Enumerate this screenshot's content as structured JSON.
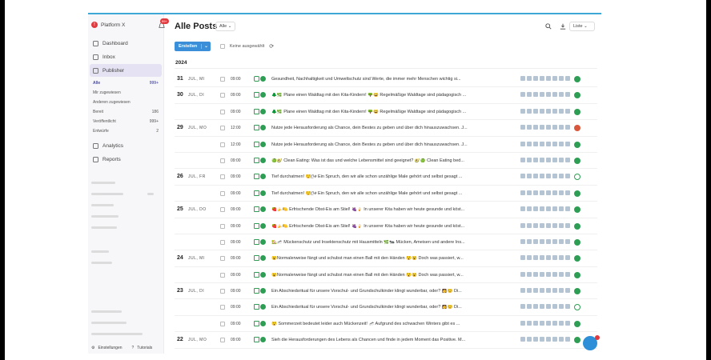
{
  "app": {
    "brand": "Platform X",
    "notification_badge": "99+",
    "title": "Alle Posts",
    "filter_value": "Alle",
    "view_value": "Liste",
    "create_label": "Erstellen",
    "selection_text": "Keine ausgewählt",
    "year": "2024"
  },
  "sidebar": {
    "nav": [
      {
        "label": "Dashboard",
        "icon": "home-icon"
      },
      {
        "label": "Inbox",
        "icon": "inbox-icon"
      },
      {
        "label": "Publisher",
        "icon": "publisher-icon",
        "active": true
      }
    ],
    "sub": [
      {
        "label": "Alle",
        "count": "999+",
        "active": true
      },
      {
        "label": "Mir zugewiesen",
        "count": ""
      },
      {
        "label": "Anderen zugewiesen",
        "count": ""
      },
      {
        "label": "Bereit",
        "count": "186"
      },
      {
        "label": "Veröffentlicht",
        "count": "999+"
      },
      {
        "label": "Entwürfe",
        "count": "2"
      }
    ],
    "nav2": [
      {
        "label": "Analytics",
        "icon": "analytics-icon"
      },
      {
        "label": "Reports",
        "icon": "reports-icon"
      }
    ],
    "footer_settings": "Einstellungen",
    "footer_tutorials": "Tutorials"
  },
  "rows": [
    {
      "day": "31",
      "dow": "JUL, MI",
      "time": "09:00",
      "ch": "link",
      "status": "green",
      "text": "Gesundheit, Nachhaltigkeit und Umweltschutz sind Werte, die immer mehr Menschen wichtig si..."
    },
    {
      "day": "30",
      "dow": "JUL, DI",
      "time": "09:00",
      "ch": "mail",
      "status": "green",
      "text": "🌲🌿 Plane einen Waldtag mit den Kita-Kindern! 🌳😀 Regelmäßige Waldtage sind pädagogisch ..."
    },
    {
      "day": "",
      "dow": "",
      "time": "09:00",
      "ch": "mail",
      "status": "green",
      "text": "🌲🌿 Plane einen Waldtag mit den Kita-Kindern! 🌳😀 Regelmäßige Waldtage sind pädagogisch ..."
    },
    {
      "day": "29",
      "dow": "JUL, MO",
      "time": "12:00",
      "ch": "mail",
      "status": "red",
      "text": "Nutze jede Herausforderung als Chance, dein Bestes zu geben und über dich hinauszuwachsen. J..."
    },
    {
      "day": "",
      "dow": "",
      "time": "12:00",
      "ch": "mail",
      "status": "green",
      "text": "Nutze jede Herausforderung als Chance, dein Bestes zu geben und über dich hinauszuwachsen. J..."
    },
    {
      "day": "",
      "dow": "",
      "time": "09:00",
      "ch": "mail",
      "status": "green",
      "text": "🍏🥑 Clean Eating: Was ist das und welche Lebensmittel sind geeignet? 🥑🍏 Clean Eating bed..."
    },
    {
      "day": "26",
      "dow": "JUL, FR",
      "time": "09:00",
      "ch": "mail",
      "status": "outline",
      "text": "Tief durchatmen! 😌🌬 Ein Spruch, den wir alle schon unzählige Male gehört und selbst gesagt ..."
    },
    {
      "day": "",
      "dow": "",
      "time": "09:00",
      "ch": "mail",
      "status": "green",
      "text": "Tief durchatmen! 😌🌬 Ein Spruch, den wir alle schon unzählige Male gehört und selbst gesagt ..."
    },
    {
      "day": "25",
      "dow": "JUL, DO",
      "time": "09:00",
      "ch": "mail",
      "status": "green",
      "text": "🍓🍌🍋 Erfrischende Obst-Eis am Stiel! 🍇🍦 In unserer Kita haben wir heute gesunde und köst..."
    },
    {
      "day": "",
      "dow": "",
      "time": "09:00",
      "ch": "mail",
      "status": "green",
      "text": "🍓🍌🍋 Erfrischende Obst-Eis am Stiel! 🍇🍦 In unserer Kita haben wir heute gesunde und köst..."
    },
    {
      "day": "",
      "dow": "",
      "time": "09:00",
      "ch": "mail",
      "status": "green",
      "text": "🏡🦟 Mückenschutz und Insektenschutz mit Hausmitteln 🌿🐜 Mücken, Ameisen und andere Ins..."
    },
    {
      "day": "24",
      "dow": "JUL, MI",
      "time": "09:00",
      "ch": "mail",
      "status": "green",
      "text": "😮Normalerweise fängt und schubst man einen Ball mit den Händen 😯😮 Doch was passiert, w..."
    },
    {
      "day": "",
      "dow": "",
      "time": "09:00",
      "ch": "mail",
      "status": "green",
      "text": "😮Normalerweise fängt und schubst man einen Ball mit den Händen 😯😮 Doch was passiert, w..."
    },
    {
      "day": "23",
      "dow": "JUL, DI",
      "time": "09:00",
      "ch": "mail",
      "status": "green",
      "text": "Ein Abschiedsritual für unsere Vorschul- und Grundschulkinder klingt wunderbar, oder? 👩😊 Di..."
    },
    {
      "day": "",
      "dow": "",
      "time": "09:00",
      "ch": "mail",
      "status": "outline",
      "text": "Ein Abschiedsritual für unsere Vorschul- und Grundschulkinder klingt wunderbar, oder? 👩😊 Di..."
    },
    {
      "day": "",
      "dow": "",
      "time": "09:00",
      "ch": "mail",
      "status": "green",
      "text": "😯 Sommerzeit bedeutet leider auch Mückenzeit! 🦟 Aufgrund des schwachen Winters gibt es ..."
    },
    {
      "day": "22",
      "dow": "JUL, MO",
      "time": "09:00",
      "ch": "mail",
      "status": "green",
      "text": "Sieh die Herausforderungen des Lebens als Chancen und finde in jedem Moment das Positive. M..."
    }
  ]
}
